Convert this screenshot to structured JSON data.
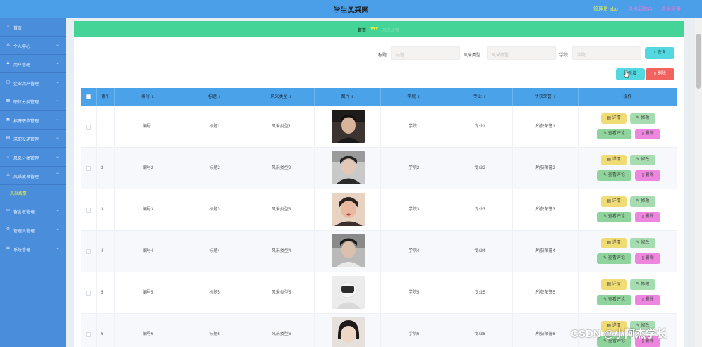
{
  "header": {
    "title": "学生风采网",
    "admin": "管理员 abo",
    "link_front": "退出到前台",
    "link_logout": "退出登录"
  },
  "sidebar": {
    "items": [
      {
        "icon": "home-icon",
        "glyph": "⌂",
        "label": "首页"
      },
      {
        "icon": "user-icon",
        "glyph": "♙",
        "label": "个人中心"
      },
      {
        "icon": "users-icon",
        "glyph": "♟",
        "label": "用户管理"
      },
      {
        "icon": "building-icon",
        "glyph": "▢",
        "label": "企业用户管理"
      },
      {
        "icon": "grid-icon",
        "glyph": "▦",
        "label": "职位分类管理"
      },
      {
        "icon": "briefcase-icon",
        "glyph": "▣",
        "label": "招聘职位管理"
      },
      {
        "icon": "document-icon",
        "glyph": "▤",
        "label": "求职投递管理"
      },
      {
        "icon": "star-icon",
        "glyph": "☆",
        "label": "风采分类管理"
      },
      {
        "icon": "person-icon",
        "glyph": "♙",
        "label": "风采故事管理"
      },
      {
        "icon": "message-icon",
        "glyph": "▭",
        "label": "留言板管理"
      },
      {
        "icon": "settings-icon",
        "glyph": "⚙",
        "label": "管理员管理"
      },
      {
        "icon": "system-icon",
        "glyph": "☰",
        "label": "系统管理"
      }
    ],
    "active_sub": "风采故事"
  },
  "breadcrumb": {
    "home": "首页",
    "separator": "♥♥♥",
    "current": "风采故事"
  },
  "filters": {
    "title_label": "标题",
    "title_placeholder": "标题",
    "type_label": "风采类型",
    "type_placeholder": "风采类型",
    "college_label": "学院",
    "college_placeholder": "学院",
    "search_label": "查询"
  },
  "toolbar": {
    "add_label": "新增",
    "delete_label": "删除"
  },
  "table": {
    "headers": [
      "索引",
      "编号",
      "标题",
      "风采类型",
      "图片",
      "学院",
      "专业",
      "所获荣誉",
      "操作"
    ],
    "rows": [
      {
        "index": "1",
        "code": "编号1",
        "title": "标题1",
        "type": "风采类型1",
        "college": "学院1",
        "major": "专业1",
        "honor": "所获荣誉1"
      },
      {
        "index": "2",
        "code": "编号2",
        "title": "标题2",
        "type": "风采类型2",
        "college": "学院2",
        "major": "专业2",
        "honor": "所获荣誉2"
      },
      {
        "index": "3",
        "code": "编号3",
        "title": "标题3",
        "type": "风采类型3",
        "college": "学院3",
        "major": "专业3",
        "honor": "所获荣誉3"
      },
      {
        "index": "4",
        "code": "编号4",
        "title": "标题4",
        "type": "风采类型4",
        "college": "学院4",
        "major": "专业4",
        "honor": "所获荣誉4"
      },
      {
        "index": "5",
        "code": "编号5",
        "title": "标题5",
        "type": "风采类型5",
        "college": "学院5",
        "major": "专业5",
        "honor": "所获荣誉5"
      },
      {
        "index": "6",
        "code": "编号6",
        "title": "标题6",
        "type": "风采类型6",
        "college": "学院6",
        "major": "专业6",
        "honor": "所获荣誉6"
      }
    ],
    "actions": {
      "detail": "详情",
      "edit": "修改",
      "view_comments": "查看评论",
      "remove": "删除"
    }
  },
  "watermark": "CSDN @小阿杰学长"
}
